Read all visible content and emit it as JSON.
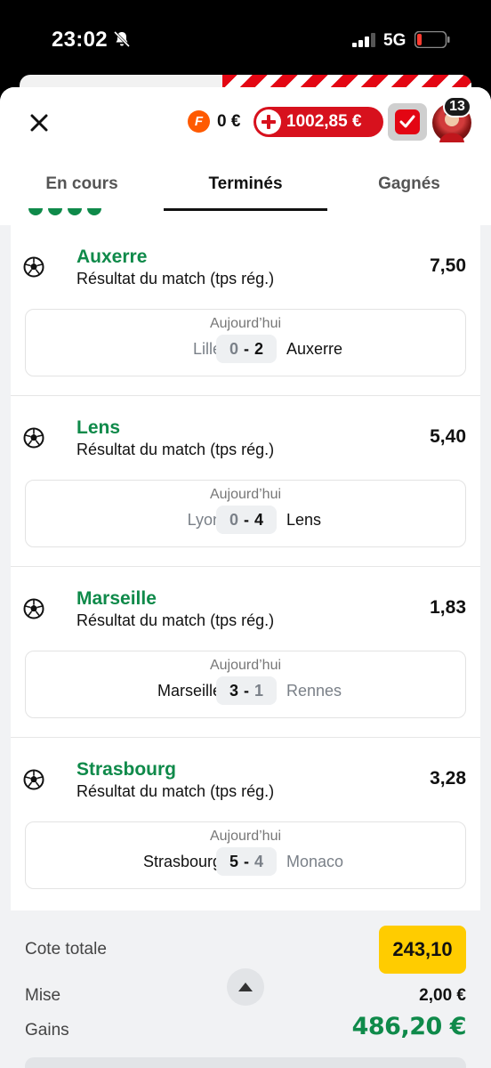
{
  "status_bar": {
    "time": "23:02",
    "network": "5G"
  },
  "header": {
    "fdj_letter": "F",
    "fdj_balance": "0 €",
    "deposit_amount": "1002,85 €",
    "notification_count": "13"
  },
  "tabs": [
    {
      "label": "En cours",
      "active": false
    },
    {
      "label": "Terminés",
      "active": true
    },
    {
      "label": "Gagnés",
      "active": false
    }
  ],
  "selections": [
    {
      "team": "Auxerre",
      "market": "Résultat du match (tps rég.)",
      "odds": "7,50",
      "date": "Aujourd’hui",
      "home": "Lille",
      "home_score": "0",
      "away": "Auxerre",
      "away_score": "2",
      "winner": "away"
    },
    {
      "team": "Lens",
      "market": "Résultat du match (tps rég.)",
      "odds": "5,40",
      "date": "Aujourd’hui",
      "home": "Lyon",
      "home_score": "0",
      "away": "Lens",
      "away_score": "4",
      "winner": "away"
    },
    {
      "team": "Marseille",
      "market": "Résultat du match (tps rég.)",
      "odds": "1,83",
      "date": "Aujourd’hui",
      "home": "Marseille",
      "home_score": "3",
      "away": "Rennes",
      "away_score": "1",
      "winner": "home"
    },
    {
      "team": "Strasbourg",
      "market": "Résultat du match (tps rég.)",
      "odds": "3,28",
      "date": "Aujourd’hui",
      "home": "Strasbourg",
      "home_score": "5",
      "away": "Monaco",
      "away_score": "4",
      "winner": "home"
    }
  ],
  "summary": {
    "total_odds_label": "Cote totale",
    "total_odds": "243,10",
    "stake_label": "Mise",
    "stake": "2,00 €",
    "gains_label": "Gains",
    "gains": "486,20 €"
  },
  "colors": {
    "brand_red": "#e30613",
    "win_green": "#0f8a4a",
    "odds_yellow": "#ffcc00"
  }
}
